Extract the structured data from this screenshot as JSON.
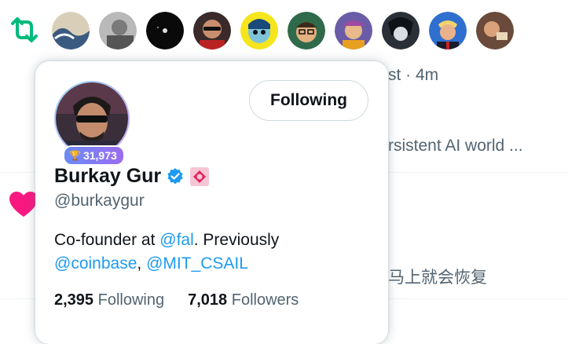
{
  "background": {
    "time_text": "st · 4m",
    "snippet_1": "rsistent AI world ...",
    "snippet_2": "马上就会恢复"
  },
  "avatar_row": {
    "count": 10
  },
  "hover_card": {
    "follow_button_label": "Following",
    "badge_count": "31,973",
    "display_name": "Burkay Gur",
    "handle": "@burkaygur",
    "bio": {
      "prefix": "Co-founder at ",
      "mention_1": "@fal",
      "middle": ". Previously",
      "mention_2": "@coinbase",
      "separator": ", ",
      "mention_3": "@MIT_CSAIL"
    },
    "following_count": "2,395",
    "following_label": "Following",
    "followers_count": "7,018",
    "followers_label": "Followers"
  },
  "colors": {
    "accent": "#1d9bf0",
    "retweet_green": "#00ba7c",
    "heart_pink": "#f91880",
    "muted_text": "#536471"
  }
}
